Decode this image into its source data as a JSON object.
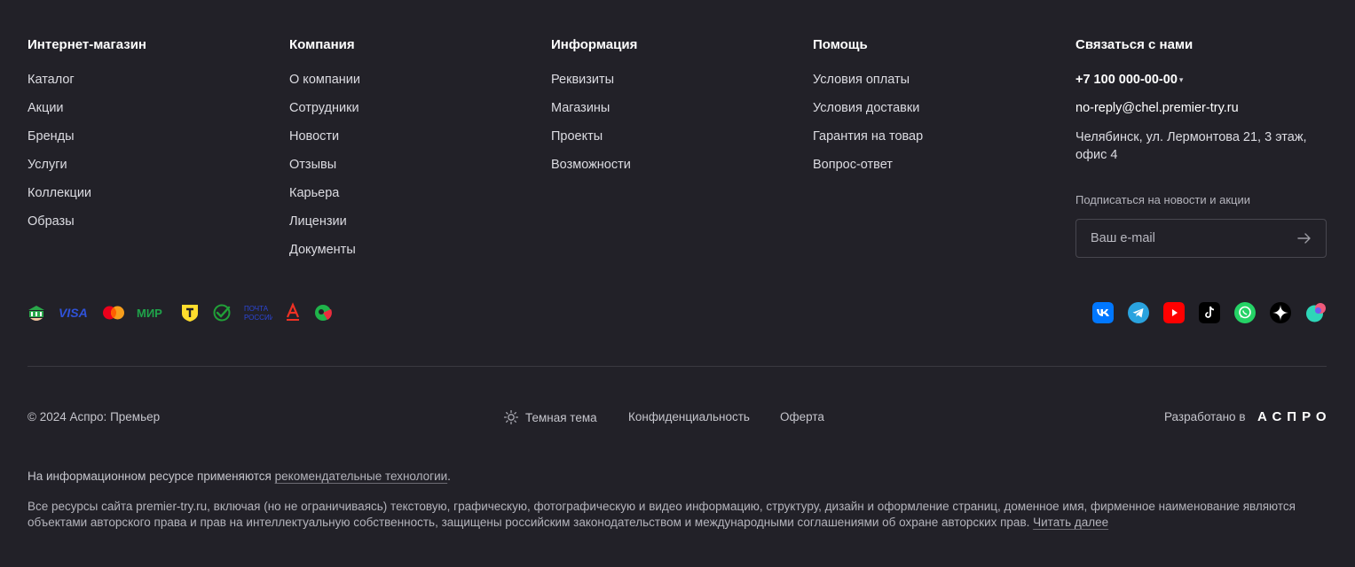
{
  "columns": [
    {
      "title": "Интернет-магазин",
      "links": [
        "Каталог",
        "Акции",
        "Бренды",
        "Услуги",
        "Коллекции",
        "Образы"
      ]
    },
    {
      "title": "Компания",
      "links": [
        "О компании",
        "Сотрудники",
        "Новости",
        "Отзывы",
        "Карьера",
        "Лицензии",
        "Документы"
      ]
    },
    {
      "title": "Информация",
      "links": [
        "Реквизиты",
        "Магазины",
        "Проекты",
        "Возможности"
      ]
    },
    {
      "title": "Помощь",
      "links": [
        "Условия оплаты",
        "Условия доставки",
        "Гарантия на товар",
        "Вопрос-ответ"
      ]
    }
  ],
  "contacts": {
    "title": "Связаться с нами",
    "phone": "+7 100 000-00-00",
    "email": "no-reply@chel.premier-try.ru",
    "address": "Челябинск, ул. Лермонтова 21, 3 этаж, офис 4",
    "subscribe_label": "Подписаться на новости и акции",
    "email_placeholder": "Ваш e-mail"
  },
  "payment_icons": [
    "sber-bank-icon",
    "visa-icon",
    "mastercard-icon",
    "mir-icon",
    "tbank-icon",
    "sberpay-icon",
    "pochta-rossii-icon",
    "alfa-bank-icon",
    "sovcombank-icon"
  ],
  "payment_text": {
    "visa": "VISA",
    "mir": "МИР",
    "pochta": "ПОЧТА РОССИИ"
  },
  "social_icons": [
    "vk-icon",
    "telegram-icon",
    "youtube-icon",
    "tiktok-icon",
    "whatsapp-icon",
    "zen-icon",
    "rutube-icon"
  ],
  "bottom": {
    "copyright": "© 2024 Аспро: Премьер",
    "theme_label": "Темная тема",
    "privacy": "Конфиденциальность",
    "offer": "Оферта",
    "developed_by": "Разработано в",
    "developer_logo": "АСПРО"
  },
  "notice": {
    "line1_prefix": "На информационном ресурсе применяются ",
    "line1_link": "рекомендательные технологии",
    "line1_suffix": ".",
    "line2_text": "Все ресурсы сайта premier-try.ru, включая (но не ограничиваясь) текстовую, графическую, фотографическую и видео информацию, структуру, дизайн и оформление страниц, доменное имя, фирменное наименование являются объектами авторского права и прав на интеллектуальную собственность, защищены российским законодательством и международными соглашениями об охране авторских прав. ",
    "line2_link": "Читать далее"
  },
  "colors": {
    "background": "#222128",
    "text": "#ececf0",
    "muted": "#c5c5cc",
    "divider": "#3a3940"
  }
}
